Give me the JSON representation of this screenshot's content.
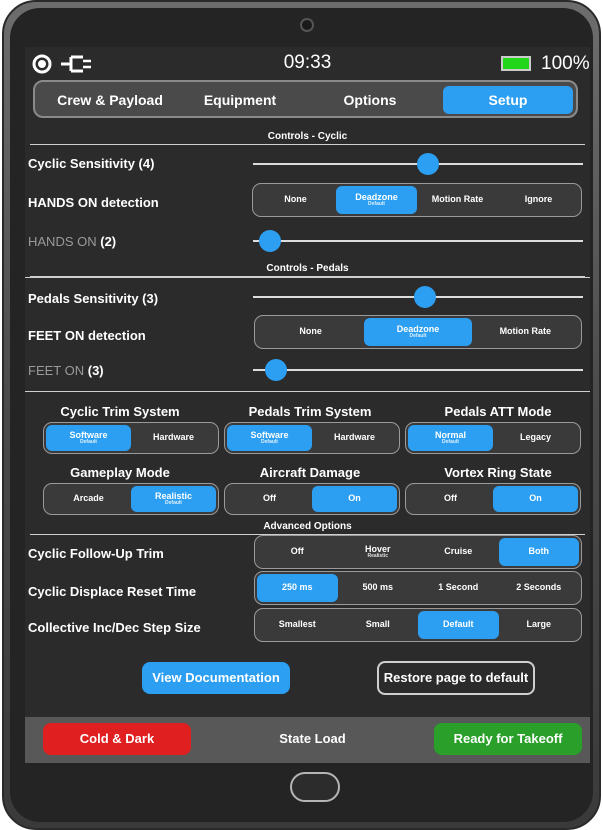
{
  "status": {
    "time": "09:33",
    "battery": "100%",
    "left_icon": "mode-circle-icon",
    "plug_icon": "power-plug-icon"
  },
  "tabs": [
    {
      "label": "Crew & Payload",
      "active": false
    },
    {
      "label": "Equipment",
      "active": false
    },
    {
      "label": "Options",
      "active": false
    },
    {
      "label": "Setup",
      "active": true
    }
  ],
  "cyclic": {
    "section_title": "Controls - Cyclic",
    "sensitivity_label": "Cyclic Sensitivity (4)",
    "sensitivity_level": 0.53,
    "hands_detection_label": "HANDS ON detection",
    "hands_detection_options": [
      {
        "label": "None",
        "sub": ""
      },
      {
        "label": "Deadzone",
        "sub": "Default",
        "selected": true
      },
      {
        "label": "Motion Rate",
        "sub": ""
      },
      {
        "label": "Ignore",
        "sub": ""
      }
    ],
    "hands_on_label": "HANDS ON",
    "hands_on_value": "(2)",
    "hands_on_level": 0.05
  },
  "pedals": {
    "section_title": "Controls - Pedals",
    "sensitivity_label": "Pedals Sensitivity (3)",
    "sensitivity_level": 0.52,
    "feet_detection_label": "FEET ON detection",
    "feet_detection_options": [
      {
        "label": "None",
        "sub": ""
      },
      {
        "label": "Deadzone",
        "sub": "Default",
        "selected": true
      },
      {
        "label": "Motion Rate",
        "sub": ""
      }
    ],
    "feet_on_label": "FEET ON",
    "feet_on_value": "(3)",
    "feet_on_level": 0.07
  },
  "systems": {
    "cyclic_trim": {
      "title": "Cyclic Trim System",
      "options": [
        {
          "label": "Software",
          "sub": "Default",
          "selected": true
        },
        {
          "label": "Hardware",
          "sub": ""
        }
      ]
    },
    "pedals_trim": {
      "title": "Pedals Trim System",
      "options": [
        {
          "label": "Software",
          "sub": "Default",
          "selected": true
        },
        {
          "label": "Hardware",
          "sub": ""
        }
      ]
    },
    "pedals_att": {
      "title": "Pedals ATT Mode",
      "options": [
        {
          "label": "Normal",
          "sub": "Default",
          "selected": true
        },
        {
          "label": "Legacy",
          "sub": ""
        }
      ]
    },
    "gameplay": {
      "title": "Gameplay Mode",
      "options": [
        {
          "label": "Arcade",
          "sub": ""
        },
        {
          "label": "Realistic",
          "sub": "Default",
          "selected": true
        }
      ]
    },
    "damage": {
      "title": "Aircraft Damage",
      "options": [
        {
          "label": "Off",
          "sub": ""
        },
        {
          "label": "On",
          "sub": "",
          "selected": true
        }
      ]
    },
    "vortex": {
      "title": "Vortex Ring State",
      "options": [
        {
          "label": "Off",
          "sub": ""
        },
        {
          "label": "On",
          "sub": "",
          "selected": true
        }
      ]
    }
  },
  "advanced": {
    "section_title": "Advanced Options",
    "follow_up": {
      "label": "Cyclic Follow-Up Trim",
      "options": [
        {
          "label": "Off",
          "sub": ""
        },
        {
          "label": "Hover",
          "sub": "Realistic"
        },
        {
          "label": "Cruise",
          "sub": ""
        },
        {
          "label": "Both",
          "sub": "",
          "selected": true
        }
      ]
    },
    "displace_reset": {
      "label": "Cyclic Displace Reset Time",
      "options": [
        {
          "label": "250 ms",
          "sub": "",
          "selected": true
        },
        {
          "label": "500 ms",
          "sub": ""
        },
        {
          "label": "1 Second",
          "sub": ""
        },
        {
          "label": "2 Seconds",
          "sub": ""
        }
      ]
    },
    "step_size": {
      "label": "Collective Inc/Dec Step Size",
      "options": [
        {
          "label": "Smallest",
          "sub": ""
        },
        {
          "label": "Small",
          "sub": ""
        },
        {
          "label": "Default",
          "sub": "",
          "selected": true
        },
        {
          "label": "Large",
          "sub": ""
        }
      ]
    }
  },
  "actions": {
    "view_docs": "View Documentation",
    "restore": "Restore page to default"
  },
  "footer": {
    "cold_dark": "Cold & Dark",
    "state_load": "State Load",
    "ready": "Ready for Takeoff"
  },
  "colors": {
    "accent": "#2c9ff2",
    "red": "#e02020",
    "green": "#2aa02a"
  }
}
